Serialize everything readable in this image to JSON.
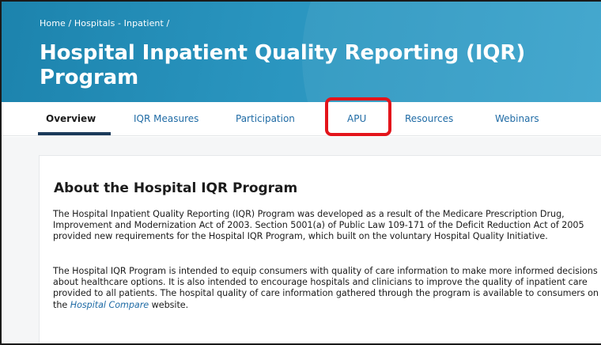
{
  "header": {
    "breadcrumb": "Home / Hospitals - Inpatient /",
    "title": "Hospital Inpatient Quality Reporting (IQR) Program"
  },
  "tabs": [
    {
      "label": "Overview",
      "active": true
    },
    {
      "label": "IQR Measures",
      "active": false
    },
    {
      "label": "Participation",
      "active": false
    },
    {
      "label": "APU",
      "active": false,
      "highlighted": true
    },
    {
      "label": "Resources",
      "active": false
    },
    {
      "label": "Webinars",
      "active": false
    }
  ],
  "main": {
    "heading": "About the Hospital IQR Program",
    "paragraph1": "The Hospital Inpatient Quality Reporting (IQR) Program was developed as a result of the Medicare Prescription Drug, Improvement and Modernization Act of 2003. Section 5001(a) of Public Law 109-171 of the Deficit Reduction Act of 2005 provided new requirements for the Hospital IQR Program, which built on the voluntary Hospital Quality Initiative.",
    "paragraph2_text": "The Hospital IQR Program is intended to equip consumers with quality of care information to make more informed decisions about healthcare options. It is also intended to encourage hospitals and clinicians to improve the quality of inpatient care provided to all patients. The hospital quality of care information gathered through the program is available to consumers on the ",
    "paragraph2_link": "Hospital Compare",
    "paragraph2_end": " website."
  },
  "colors": {
    "hero": "#2a95bf",
    "link": "#1f6ba5",
    "highlight": "#e3141b",
    "active_tab_underline": "#1b3a5a"
  }
}
